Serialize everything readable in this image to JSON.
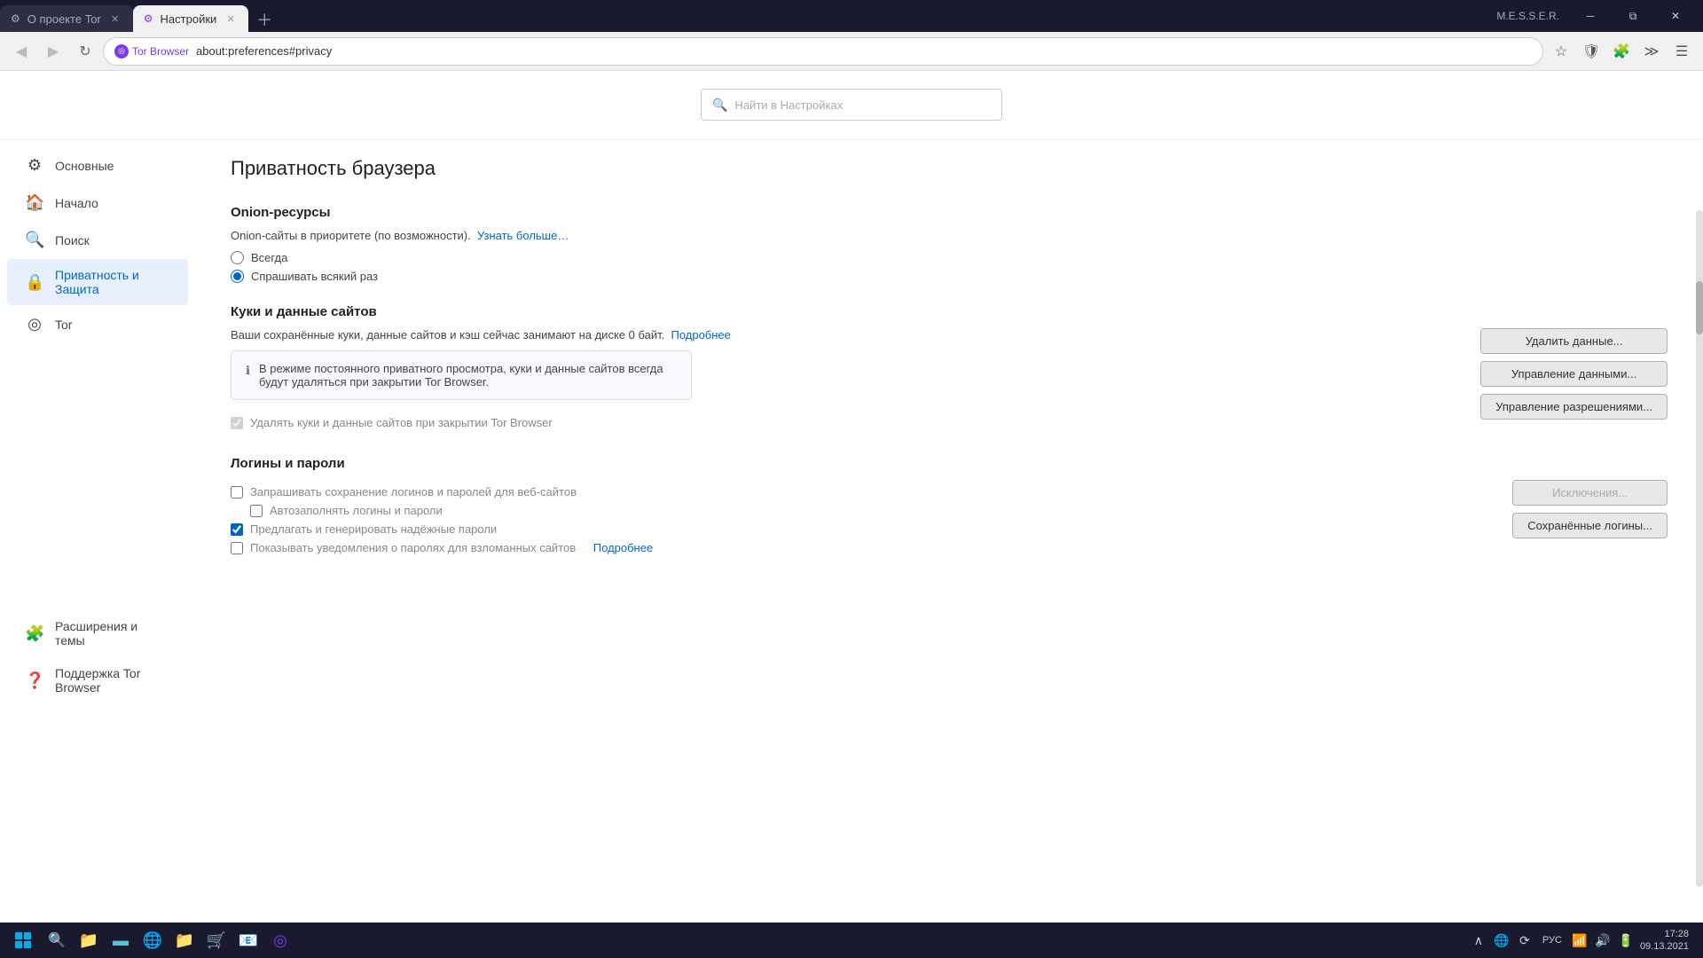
{
  "window": {
    "title": "M.E.S.S.E.R.",
    "tabs": [
      {
        "id": "tab1",
        "label": "О проекте Tor",
        "active": false,
        "icon": "⚙"
      },
      {
        "id": "tab2",
        "label": "Настройки",
        "active": true,
        "icon": "⚙"
      }
    ],
    "add_tab_title": "Открыть новую вкладку"
  },
  "navbar": {
    "back_title": "Назад",
    "forward_title": "Вперёд",
    "reload_title": "Перезагрузить страницу",
    "tor_badge": "Tor Browser",
    "address": "about:preferences#privacy",
    "bookmark_title": "Добавить в закладки",
    "shield_title": "Защита",
    "extension_title": "Расширения",
    "more_title": "Открыть меню приложения"
  },
  "search": {
    "placeholder": "Найти в Настройках"
  },
  "sidebar": {
    "items": [
      {
        "id": "general",
        "label": "Основные",
        "icon": "⚙"
      },
      {
        "id": "home",
        "label": "Начало",
        "icon": "🏠"
      },
      {
        "id": "search",
        "label": "Поиск",
        "icon": "🔍"
      },
      {
        "id": "privacy",
        "label": "Приватность и Защита",
        "icon": "🔒",
        "active": true
      },
      {
        "id": "tor",
        "label": "Tor",
        "icon": "◎"
      }
    ],
    "bottom_items": [
      {
        "id": "extensions",
        "label": "Расширения и темы",
        "icon": "🧩"
      },
      {
        "id": "support",
        "label": "Поддержка Tor Browser",
        "icon": "❓"
      }
    ]
  },
  "content": {
    "page_title": "Приватность браузера",
    "sections": {
      "onion": {
        "title": "Onion-ресурсы",
        "desc": "Onion-сайты в приоритете (по возможности).",
        "learn_more": "Узнать больше…",
        "options": [
          {
            "id": "always",
            "label": "Всегда",
            "checked": false
          },
          {
            "id": "ask",
            "label": "Спрашивать всякий раз",
            "checked": true
          }
        ]
      },
      "cookies": {
        "title": "Куки и данные сайтов",
        "desc": "Ваши сохранённые куки, данные сайтов и кэш сейчас занимают на диске 0 байт.",
        "details_link": "Подробнее",
        "info_text": "В режиме постоянного приватного просмотра, куки и данные сайтов всегда будут удаляться при закрытии Tor Browser.",
        "buttons": [
          {
            "id": "delete-data",
            "label": "Удалить данные..."
          },
          {
            "id": "manage-data",
            "label": "Управление данными..."
          },
          {
            "id": "manage-perms",
            "label": "Управление разрешениями..."
          }
        ],
        "checkbox": {
          "label": "Удалять куки и данные сайтов при закрытии Tor Browser",
          "checked": true,
          "disabled": true
        }
      },
      "passwords": {
        "title": "Логины и пароли",
        "checkboxes": [
          {
            "id": "ask-save",
            "label": "Запрашивать сохранение логинов и паролей для веб-сайтов",
            "checked": false,
            "disabled": false
          },
          {
            "id": "autofill",
            "label": "Автозаполнять логины и пароли",
            "checked": false,
            "disabled": false
          },
          {
            "id": "suggest-strong",
            "label": "Предлагать и генерировать надёжные пароли",
            "checked": true,
            "disabled": false
          },
          {
            "id": "breach-alerts",
            "label": "Показывать уведомления о паролях для взломанных сайтов",
            "checked": false,
            "disabled": false
          }
        ],
        "exceptions_btn": "Исключения...",
        "saved_btn": "Сохранённые логины...",
        "learn_more_breach": "Подробнее"
      }
    }
  },
  "taskbar": {
    "time": "17:28",
    "date": "09.13.2021",
    "lang": "РУС",
    "icons": [
      "🪟",
      "🔍",
      "📁",
      "▬",
      "🌐",
      "📁",
      "🛒",
      "📧",
      "◎"
    ]
  }
}
